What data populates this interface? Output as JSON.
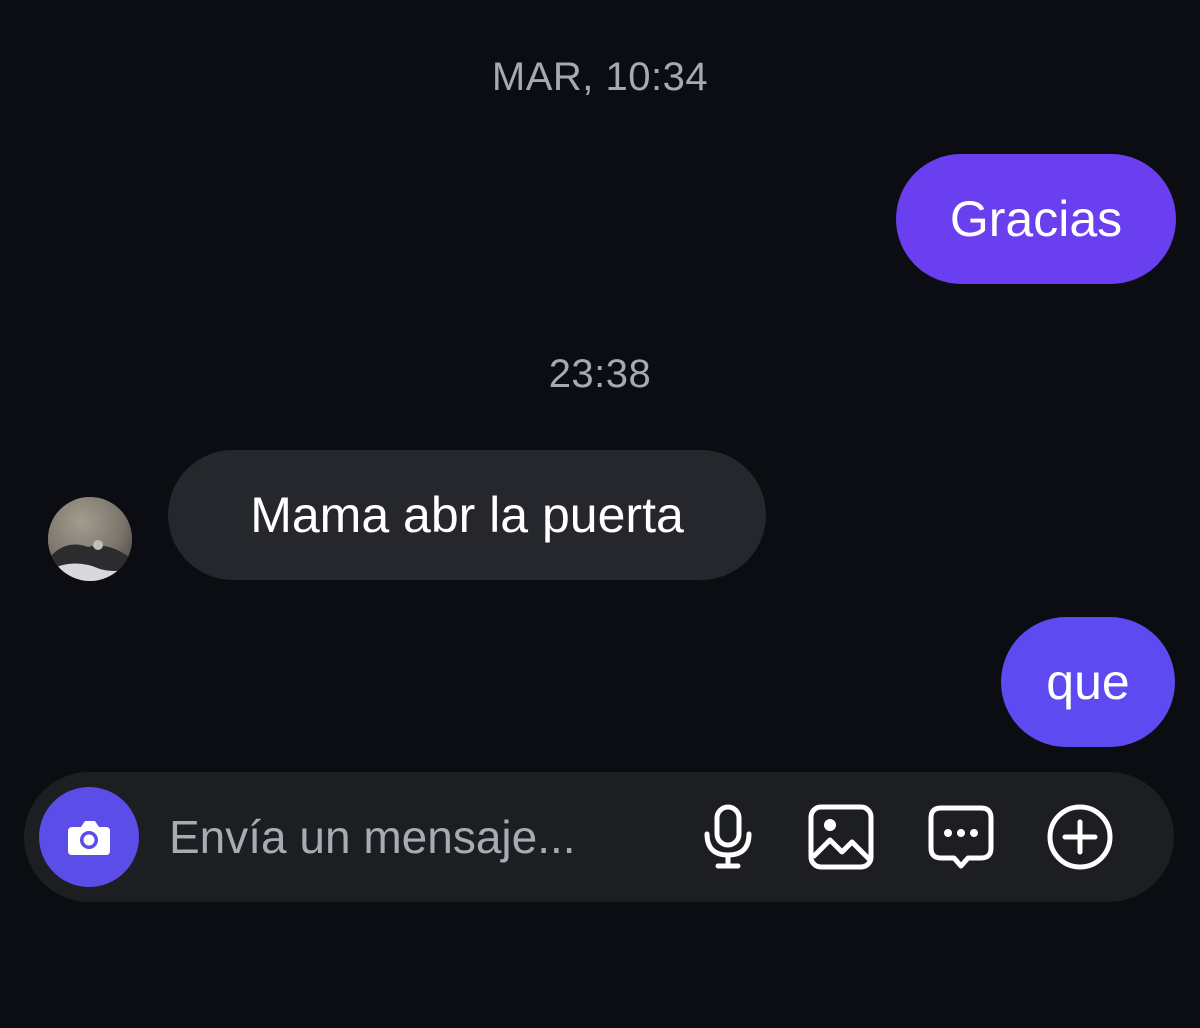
{
  "conversation": {
    "timestamps": [
      "MAR, 10:34",
      "23:38"
    ],
    "messages": [
      {
        "direction": "outgoing",
        "text": "Gracias"
      },
      {
        "direction": "incoming",
        "text": "Mama abr la puerta"
      },
      {
        "direction": "outgoing",
        "text": "que"
      }
    ]
  },
  "composer": {
    "placeholder": "Envía un mensaje...",
    "actions": [
      "camera-icon",
      "microphone-icon",
      "gallery-icon",
      "sticker-icon",
      "add-icon"
    ]
  },
  "colors": {
    "background": "#0b0d12",
    "outgoing_bubble": "#6a3ff0",
    "outgoing_bubble_alt": "#5d4af0",
    "incoming_bubble": "#25272c",
    "composer": "#1c1e22",
    "camera_button": "#5b4de8",
    "timestamp_text": "#a4a9b4",
    "placeholder_text": "#a7abb4"
  }
}
